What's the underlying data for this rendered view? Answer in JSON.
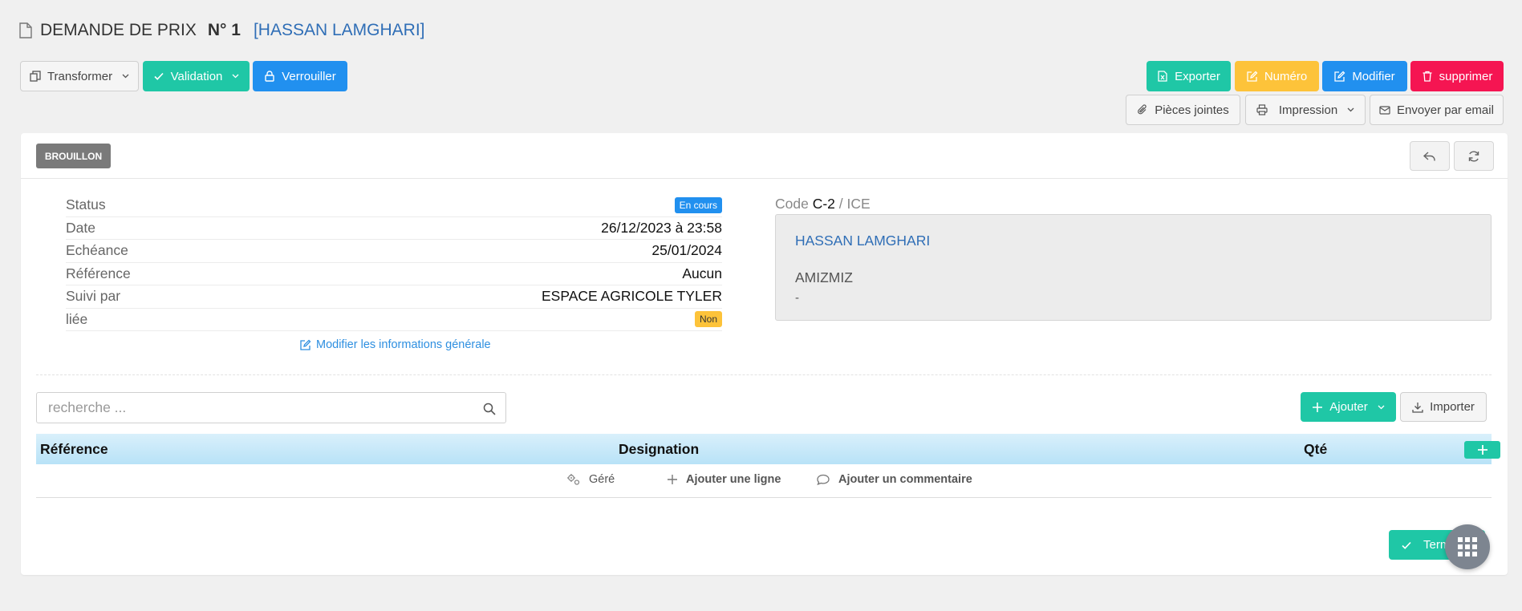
{
  "page": {
    "doc_type": "DEMANDE DE PRIX",
    "number": "N° 1",
    "client_tag": "[HASSAN LAMGHARI]"
  },
  "toolbar_left": {
    "transform": "Transformer",
    "validation": "Validation",
    "lock": "Verrouiller"
  },
  "toolbar_right": {
    "export": "Exporter",
    "numero": "Numéro",
    "modify": "Modifier",
    "delete": "supprimer",
    "attachments": "Pièces jointes",
    "print": "Impression",
    "email": "Envoyer par email"
  },
  "card": {
    "status_badge": "BROUILLON"
  },
  "info": {
    "status_label": "Status",
    "status_value": "En cours",
    "date_label": "Date",
    "date_value": "26/12/2023 à 23:58",
    "due_label": "Echéance",
    "due_value": "25/01/2024",
    "ref_label": "Référence",
    "ref_value": "Aucun",
    "followed_label": "Suivi par",
    "followed_value": "ESPACE AGRICOLE TYLER",
    "linked_label": "liée",
    "linked_value": "Non",
    "modify_link": "Modifier les informations générale"
  },
  "client": {
    "code_label": "Code",
    "code_value": "C-2",
    "code_suffix": "/ ICE",
    "name": "HASSAN LAMGHARI",
    "city": "AMIZMIZ",
    "extra": "-"
  },
  "lines": {
    "search_placeholder": "recherche ...",
    "add_button": "Ajouter",
    "import_button": "Importer",
    "col_ref": "Référence",
    "col_designation": "Designation",
    "col_qty": "Qté",
    "act_managed": "Géré",
    "act_add_line": "Ajouter une ligne",
    "act_add_comment": "Ajouter un commentaire"
  },
  "footer": {
    "finish_button": "Terminer"
  },
  "colors": {
    "teal": "#1fc7a6",
    "blue": "#2190ef",
    "yellow": "#fdc33a",
    "red": "#f51552",
    "link": "#2f6eb6"
  }
}
